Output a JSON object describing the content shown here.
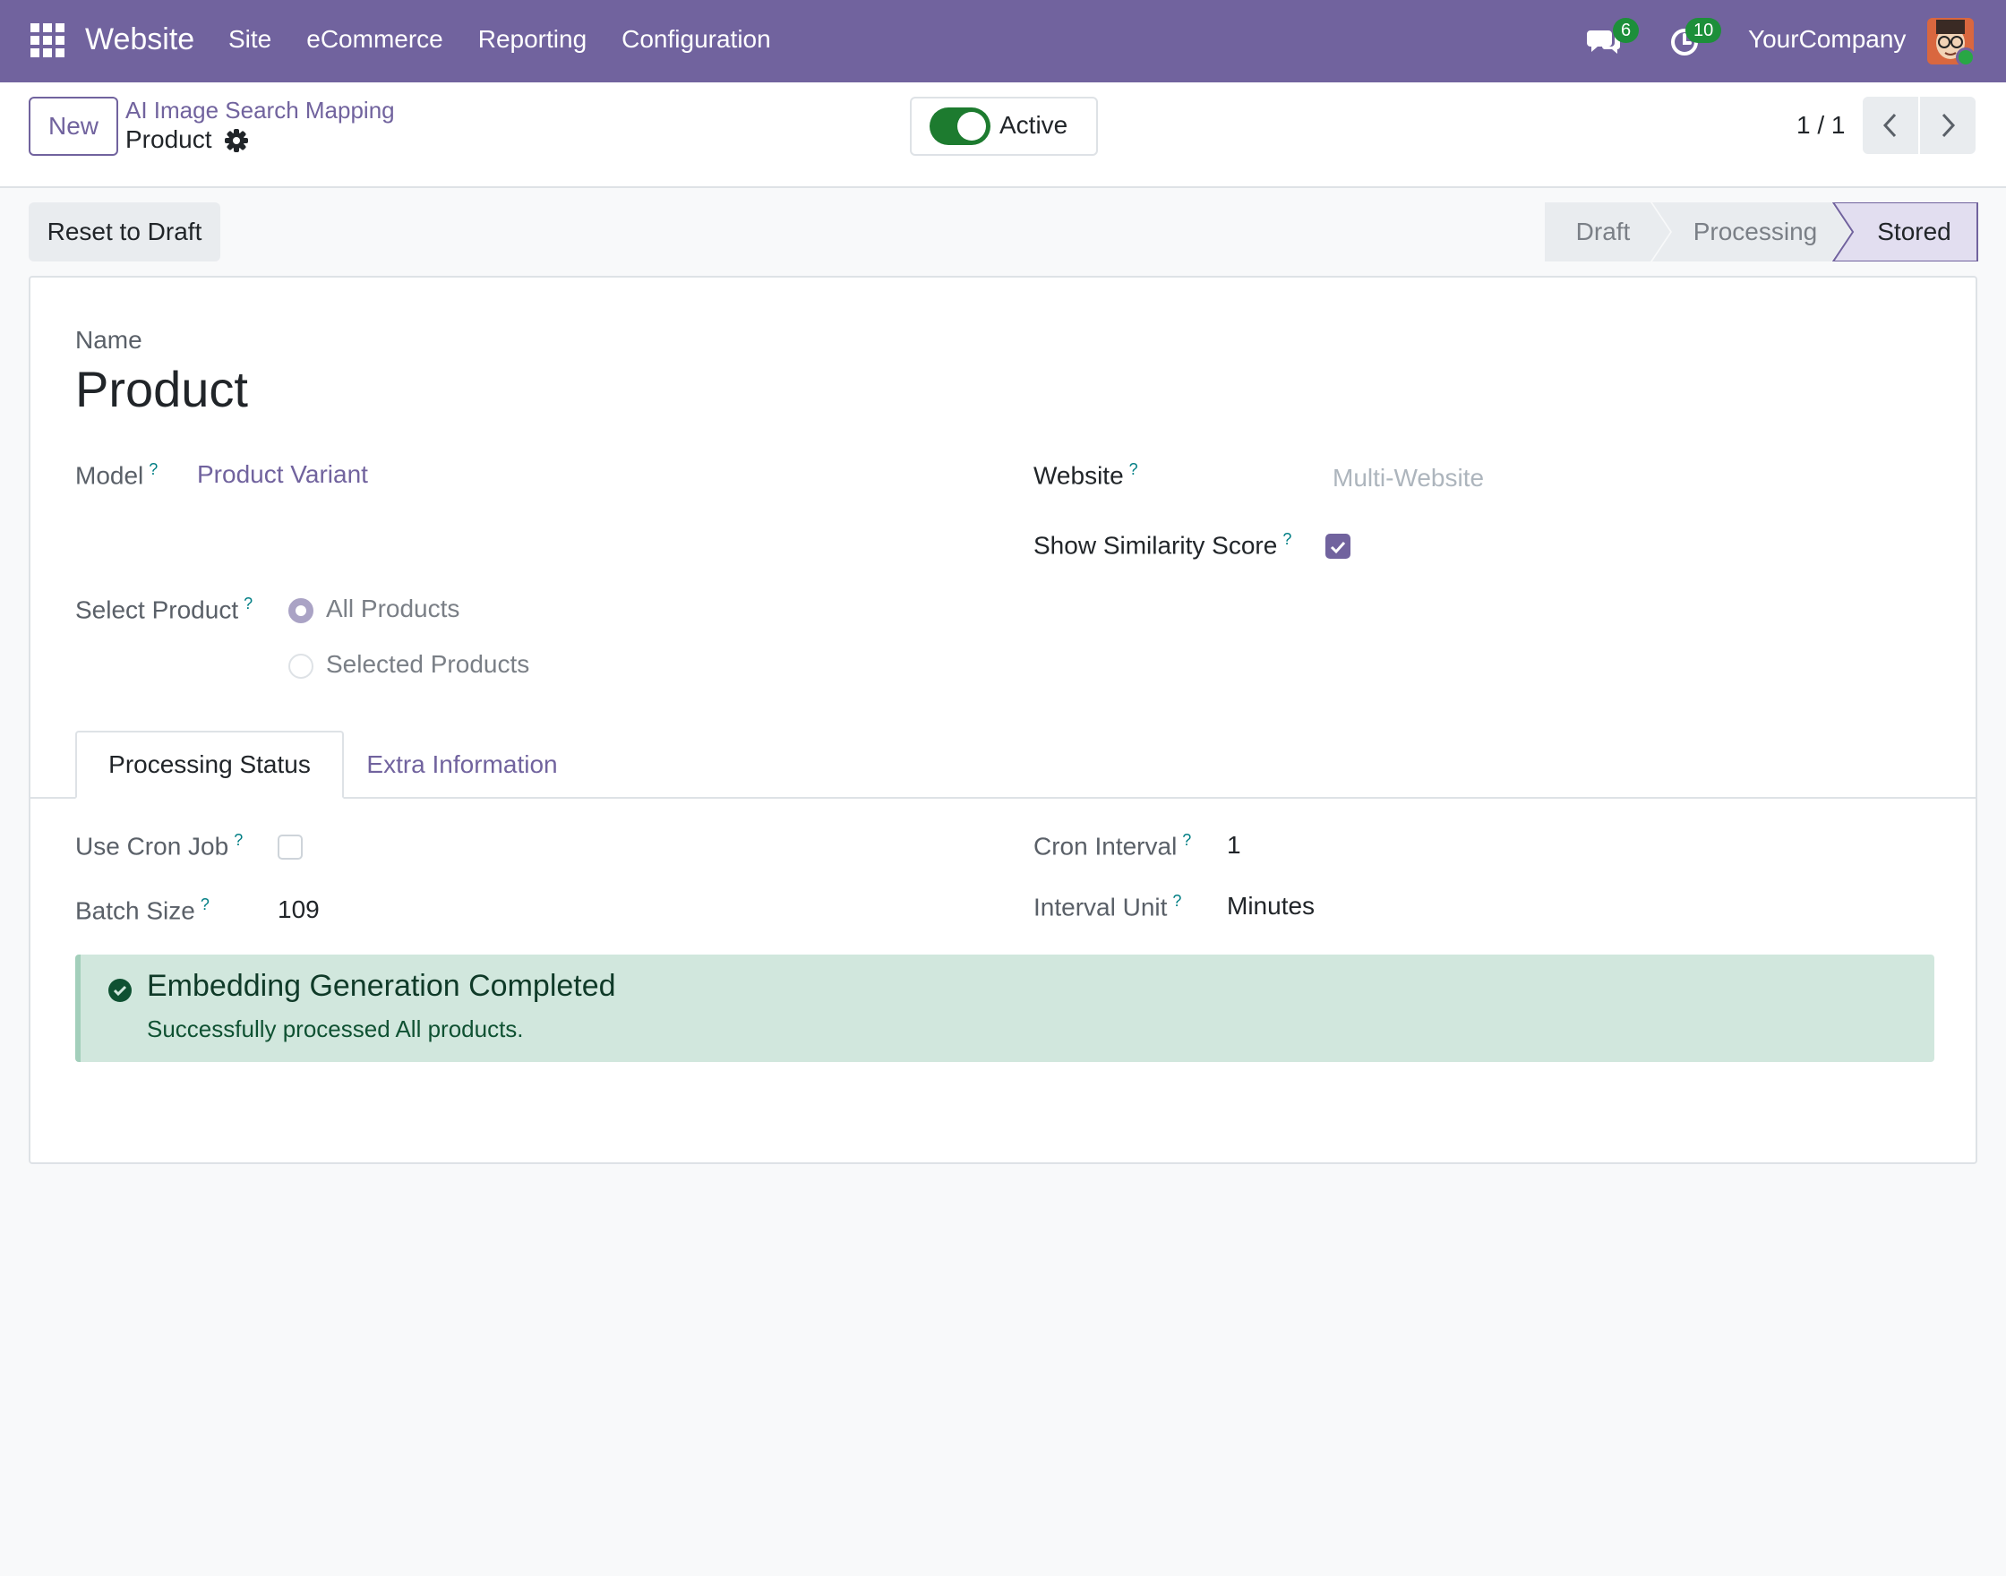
{
  "navbar": {
    "brand": "Website",
    "menu": [
      "Site",
      "eCommerce",
      "Reporting",
      "Configuration"
    ],
    "messages_count": "6",
    "activities_count": "10",
    "company": "YourCompany"
  },
  "control_panel": {
    "new_label": "New",
    "breadcrumb_parent": "AI Image Search Mapping",
    "breadcrumb_current": "Product",
    "active_label": "Active",
    "active_on": true,
    "pager": "1 / 1"
  },
  "status_bar": {
    "reset_label": "Reset to Draft",
    "stages": [
      {
        "label": "Draft",
        "state": "done"
      },
      {
        "label": "Processing",
        "state": "done"
      },
      {
        "label": "Stored",
        "state": "current"
      }
    ]
  },
  "form": {
    "name_label": "Name",
    "name_value": "Product",
    "model_label": "Model",
    "model_value": "Product Variant",
    "website_label": "Website",
    "website_placeholder": "Multi-Website",
    "similarity_label": "Show Similarity Score",
    "similarity_checked": true,
    "select_product_label": "Select Product",
    "select_options": [
      {
        "label": "All Products",
        "checked": true
      },
      {
        "label": "Selected Products",
        "checked": false
      }
    ],
    "tabs": [
      "Processing Status",
      "Extra Information"
    ],
    "active_tab": "Processing Status",
    "use_cron_label": "Use Cron Job",
    "use_cron_checked": false,
    "batch_size_label": "Batch Size",
    "batch_size_value": "109",
    "cron_interval_label": "Cron Interval",
    "cron_interval_value": "1",
    "interval_unit_label": "Interval Unit",
    "interval_unit_value": "Minutes",
    "help_marker": "?"
  },
  "alert": {
    "title": "Embedding Generation Completed",
    "text": "Successfully processed All products."
  },
  "colors": {
    "brand": "#71639e",
    "success": "#1d7b2f",
    "alert_bg": "#d1e7dd"
  }
}
